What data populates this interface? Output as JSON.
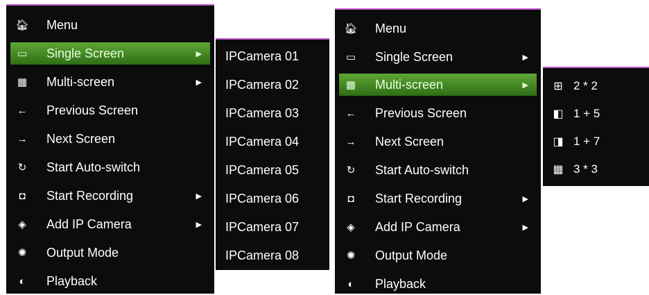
{
  "left_menu": {
    "items": [
      {
        "icon": "home-icon",
        "glyph": "🏠︎",
        "label": "Menu"
      },
      {
        "icon": "monitor-icon",
        "glyph": "▭",
        "label": "Single Screen",
        "arrow": "▶"
      },
      {
        "icon": "multiscreen-icon",
        "glyph": "▦",
        "label": "Multi-screen",
        "arrow": "▶"
      },
      {
        "icon": "arrow-left-icon",
        "glyph": "←",
        "label": "Previous Screen"
      },
      {
        "icon": "arrow-right-icon",
        "glyph": "→",
        "label": "Next Screen"
      },
      {
        "icon": "refresh-icon",
        "glyph": "↻",
        "label": "Start Auto-switch"
      },
      {
        "icon": "record-icon",
        "glyph": "◘",
        "label": "Start Recording",
        "arrow": "▶"
      },
      {
        "icon": "camera-add-icon",
        "glyph": "◈",
        "label": "Add IP Camera",
        "arrow": "▶"
      },
      {
        "icon": "output-mode-icon",
        "glyph": "✺",
        "label": "Output Mode"
      },
      {
        "icon": "playback-icon",
        "glyph": "◐",
        "label": "Playback"
      }
    ],
    "selected_index": 1
  },
  "camera_submenu": {
    "items": [
      "IPCamera 01",
      "IPCamera 02",
      "IPCamera 03",
      "IPCamera 04",
      "IPCamera 05",
      "IPCamera 06",
      "IPCamera 07",
      "IPCamera 08"
    ]
  },
  "right_menu": {
    "items": [
      {
        "icon": "home-icon",
        "glyph": "🏠︎",
        "label": "Menu"
      },
      {
        "icon": "monitor-icon",
        "glyph": "▭",
        "label": "Single Screen",
        "arrow": "▶"
      },
      {
        "icon": "multiscreen-icon",
        "glyph": "▦",
        "label": "Multi-screen",
        "arrow": "▶"
      },
      {
        "icon": "arrow-left-icon",
        "glyph": "←",
        "label": "Previous Screen"
      },
      {
        "icon": "arrow-right-icon",
        "glyph": "→",
        "label": "Next Screen"
      },
      {
        "icon": "refresh-icon",
        "glyph": "↻",
        "label": "Start Auto-switch"
      },
      {
        "icon": "record-icon",
        "glyph": "◘",
        "label": "Start Recording",
        "arrow": "▶"
      },
      {
        "icon": "camera-add-icon",
        "glyph": "◈",
        "label": "Add IP Camera",
        "arrow": "▶"
      },
      {
        "icon": "output-mode-icon",
        "glyph": "✺",
        "label": "Output Mode"
      },
      {
        "icon": "playback-icon",
        "glyph": "◐",
        "label": "Playback"
      }
    ],
    "selected_index": 2
  },
  "layout_submenu": {
    "items": [
      {
        "icon": "grid-2x2-icon",
        "glyph": "⊞",
        "label": "2 * 2"
      },
      {
        "icon": "grid-1plus5-icon",
        "glyph": "◧",
        "label": "1 + 5"
      },
      {
        "icon": "grid-1plus7-icon",
        "glyph": "◨",
        "label": "1 + 7"
      },
      {
        "icon": "grid-3x3-icon",
        "glyph": "▦",
        "label": "3 * 3"
      }
    ]
  },
  "colors": {
    "menu_bg": "#0c0c0c",
    "selected_green": "#4e9a2a",
    "accent_border": "#c75bd6"
  }
}
